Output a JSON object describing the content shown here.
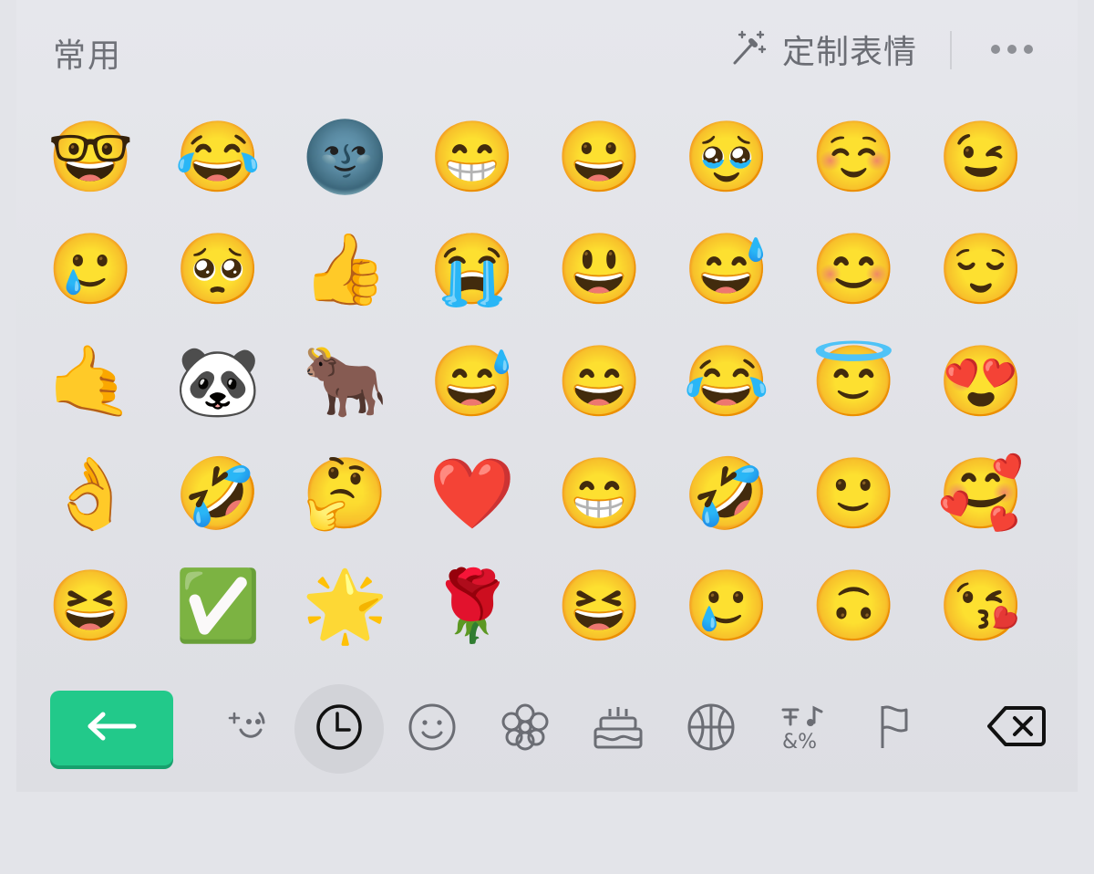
{
  "header": {
    "section_title": "常用",
    "custom_label": "定制表情",
    "custom_icon": "magic-wand-icon",
    "more_icon": "more-dots-icon"
  },
  "emoji_grid": [
    {
      "emoji": "🤓",
      "name": "nerd-face"
    },
    {
      "emoji": "😂",
      "name": "face-with-tears-of-joy"
    },
    {
      "emoji": "🌚",
      "name": "new-moon-face"
    },
    {
      "emoji": "😁",
      "name": "beaming-face"
    },
    {
      "emoji": "😀",
      "name": "grinning-face"
    },
    {
      "emoji": "🥹",
      "name": "face-holding-back-tears"
    },
    {
      "emoji": "☺️",
      "name": "smiling-face"
    },
    {
      "emoji": "😉",
      "name": "winking-face"
    },
    {
      "emoji": "🥲",
      "name": "smiling-face-with-tear"
    },
    {
      "emoji": "🥺",
      "name": "pleading-face"
    },
    {
      "emoji": "👍",
      "name": "thumbs-up"
    },
    {
      "emoji": "😭",
      "name": "loudly-crying-face"
    },
    {
      "emoji": "😃",
      "name": "grinning-face-big-eyes"
    },
    {
      "emoji": "😅",
      "name": "grinning-face-with-sweat"
    },
    {
      "emoji": "😊",
      "name": "smiling-face-with-smiling-eyes"
    },
    {
      "emoji": "😌",
      "name": "relieved-face"
    },
    {
      "emoji": "🤙",
      "name": "call-me-hand"
    },
    {
      "emoji": "🐼",
      "name": "panda"
    },
    {
      "emoji": "🐂",
      "name": "ox"
    },
    {
      "emoji": "😅",
      "name": "grinning-face-with-sweat"
    },
    {
      "emoji": "😄",
      "name": "grinning-face-smiling-eyes"
    },
    {
      "emoji": "😂",
      "name": "face-with-tears-of-joy"
    },
    {
      "emoji": "😇",
      "name": "smiling-face-with-halo"
    },
    {
      "emoji": "😍",
      "name": "heart-eyes"
    },
    {
      "emoji": "👌",
      "name": "ok-hand"
    },
    {
      "emoji": "🤣",
      "name": "rolling-on-the-floor-laughing"
    },
    {
      "emoji": "🤔",
      "name": "thinking-face"
    },
    {
      "emoji": "❤️",
      "name": "red-heart"
    },
    {
      "emoji": "😁",
      "name": "beaming-face"
    },
    {
      "emoji": "🤣",
      "name": "rolling-on-the-floor-laughing"
    },
    {
      "emoji": "🙂",
      "name": "slightly-smiling-face"
    },
    {
      "emoji": "🥰",
      "name": "smiling-face-with-hearts"
    },
    {
      "emoji": "😆",
      "name": "grinning-squinting-face"
    },
    {
      "emoji": "✅",
      "name": "check-mark-button"
    },
    {
      "emoji": "🌟",
      "name": "glowing-star"
    },
    {
      "emoji": "🌹",
      "name": "rose"
    },
    {
      "emoji": "😆",
      "name": "grinning-squinting-face"
    },
    {
      "emoji": "🥲",
      "name": "smiling-face-with-tear"
    },
    {
      "emoji": "🙃",
      "name": "upside-down-face"
    },
    {
      "emoji": "😘",
      "name": "face-blowing-kiss"
    }
  ],
  "toolbar": {
    "send_icon": "arrow-left-icon",
    "tabs": [
      {
        "icon": "sparkle-face-icon",
        "active": false
      },
      {
        "icon": "clock-icon",
        "active": true
      },
      {
        "icon": "smiley-icon",
        "active": false
      },
      {
        "icon": "flower-icon",
        "active": false
      },
      {
        "icon": "cake-icon",
        "active": false
      },
      {
        "icon": "basketball-icon",
        "active": false
      },
      {
        "icon": "symbols-icon",
        "active": false
      },
      {
        "icon": "flag-icon",
        "active": false
      }
    ],
    "backspace_icon": "backspace-icon"
  },
  "colors": {
    "background": "#e3e4e9",
    "accent_green": "#22c98a",
    "icon_gray": "#6b6d74",
    "active_tab_bg": "#d2d3d8"
  }
}
